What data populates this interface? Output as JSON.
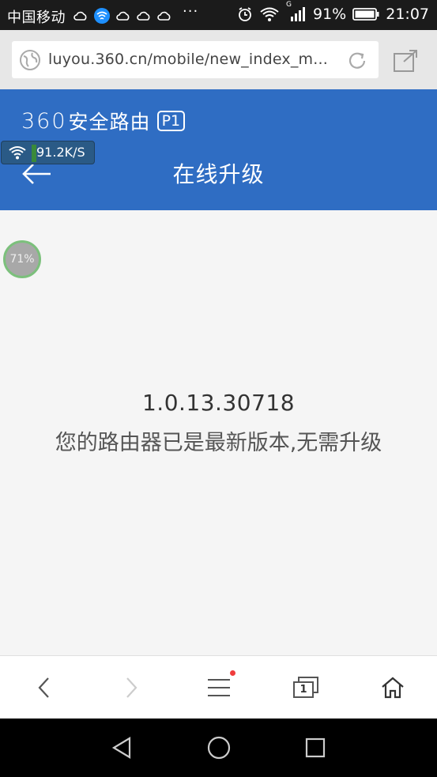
{
  "status_bar": {
    "carrier": "中国移动",
    "dots": "···",
    "signal_label": "G",
    "battery": "91%",
    "time": "21:07"
  },
  "address_bar": {
    "url": "luyou.360.cn/mobile/new_index_m..."
  },
  "header": {
    "brand_number": "360",
    "brand_name": "安全路由",
    "brand_model": "P1",
    "title": "在线升级"
  },
  "overlay": {
    "speed": "91.2K/S",
    "cpu_percent": "71%"
  },
  "content": {
    "version": "1.0.13.30718",
    "message": "您的路由器已是最新版本,无需升级"
  },
  "browser_bar": {
    "tab_count": "1"
  },
  "icons": {
    "globe": "globe-icon",
    "reload": "reload-icon",
    "share": "share-icon",
    "back": "back-arrow-icon",
    "home": "home-icon"
  },
  "colors": {
    "header_bg": "#2f6dc3",
    "notification_dot": "#f03c3c"
  }
}
